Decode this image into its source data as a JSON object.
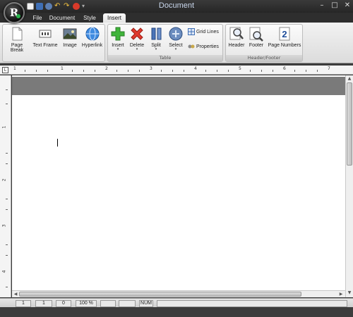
{
  "app": {
    "title": "Document",
    "orb_letter": "R"
  },
  "window_controls": {
    "minimize": "–",
    "maximize": "□",
    "close": "✕"
  },
  "tabs": [
    "File",
    "Document",
    "Style",
    "Insert"
  ],
  "ribbon": {
    "insert_group": {
      "page_break": "Page Break",
      "text_frame": "Text Frame",
      "image": "Image",
      "hyperlink": "Hyperlink"
    },
    "table_group": {
      "label": "Table",
      "insert": "Insert",
      "delete": "Delete",
      "split": "Split",
      "select": "Select",
      "grid_lines": "Grid Lines",
      "properties": "Properties"
    },
    "header_footer_group": {
      "label": "Header/Footer",
      "header": "Header",
      "footer": "Footer",
      "page_numbers": "Page Numbers",
      "page_numbers_glyph": "2"
    }
  },
  "ruler": {
    "corner": "L",
    "h_numbers": [
      "1",
      "1",
      "2",
      "3",
      "4",
      "5",
      "6",
      "7"
    ],
    "v_numbers": [
      "1",
      "2",
      "3",
      "4"
    ]
  },
  "statusbar": {
    "page": "1",
    "pages": "1",
    "column": "0",
    "zoom": "100 %",
    "cell5": "",
    "cell6": "",
    "num": "NUM"
  },
  "colors": {
    "accent": "#3f6fb5",
    "titlebar": "#262626",
    "doc_band": "#7a7a7a"
  }
}
